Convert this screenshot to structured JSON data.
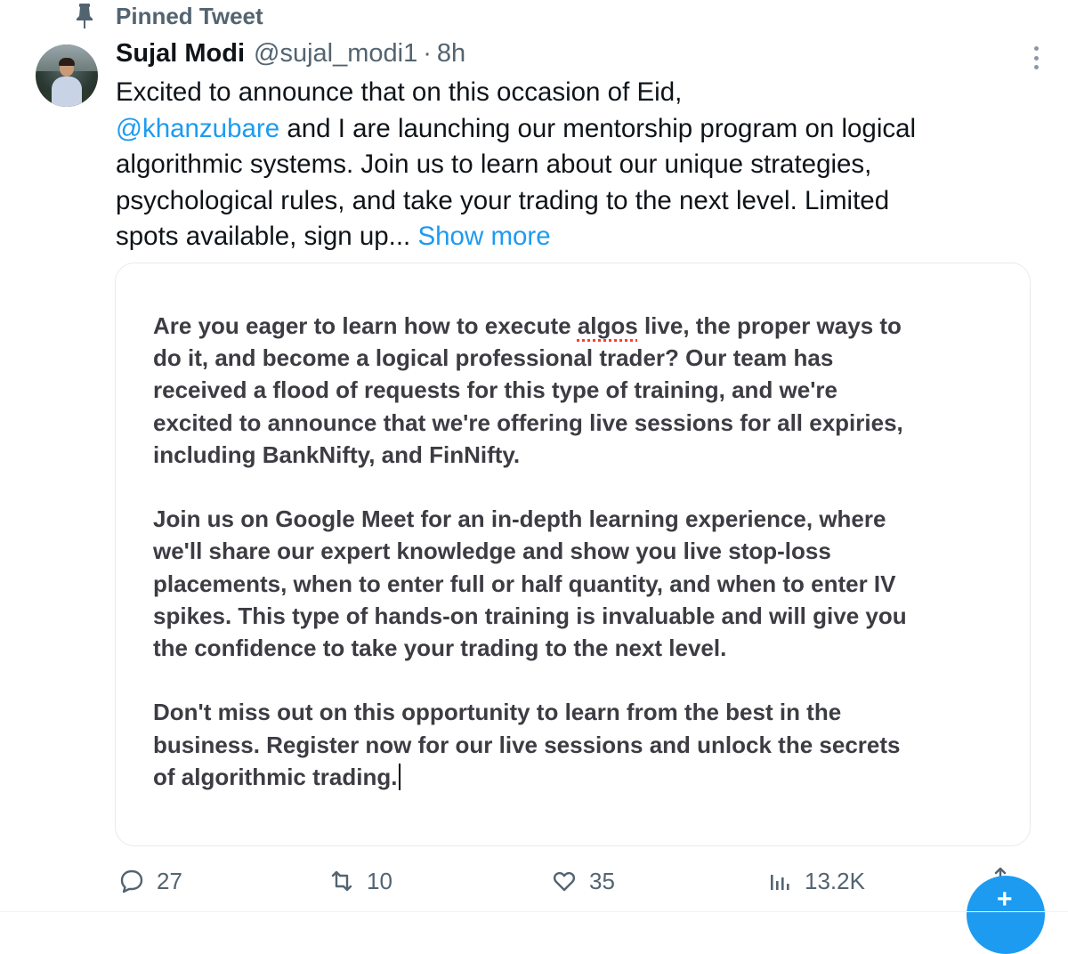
{
  "pinned": {
    "label": "Pinned Tweet",
    "icon": "pin-icon"
  },
  "tweet": {
    "author_name": "Sujal Modi",
    "handle": "@sujal_modi1",
    "separator": "·",
    "time": "8h",
    "text": {
      "line1": "Excited to announce that on this occasion of Eid,",
      "mention": "@khanzubare",
      "line2_rest": " and I are launching our mentorship program on logical",
      "line3": "algorithmic systems. Join us to learn about our unique strategies,",
      "line4": "psychological rules, and take your trading to the next level. Limited",
      "line5": "spots available, sign up... ",
      "show_more": "Show more"
    }
  },
  "media": {
    "p1": {
      "l1_pre": "Are you eager to learn how to execute ",
      "l1_underlined": "algos",
      "l1_post": " live, the proper ways to",
      "l2": "do it, and become a logical professional trader? Our team has",
      "l3": "received a flood of requests for this type of training, and we're",
      "l4": "excited to announce that we're offering live sessions for all expiries,",
      "l5": "including BankNifty, and FinNifty."
    },
    "p2": {
      "l1": "Join us on Google Meet for an in-depth learning experience, where",
      "l2": "we'll share our expert knowledge and show you live stop-loss",
      "l3": "placements, when to enter full or half quantity, and when to enter IV",
      "l4": "spikes. This type of hands-on training is invaluable and will give you",
      "l5": "the confidence to take your trading to the next level."
    },
    "p3": {
      "l1": "Don't miss out on this opportunity to learn from the best in the",
      "l2": "business. Register now for our live sessions and unlock the secrets",
      "l3": "of algorithmic trading."
    }
  },
  "actions": {
    "reply": {
      "count": "27",
      "icon": "reply-icon"
    },
    "retweet": {
      "count": "10",
      "icon": "retweet-icon"
    },
    "like": {
      "count": "35",
      "icon": "heart-icon"
    },
    "views": {
      "count": "13.2K",
      "icon": "views-icon"
    }
  },
  "colors": {
    "accent": "#1d9bf0",
    "secondary_text": "#536471",
    "primary_text": "#0f1419",
    "card_text": "#3c3c43"
  }
}
